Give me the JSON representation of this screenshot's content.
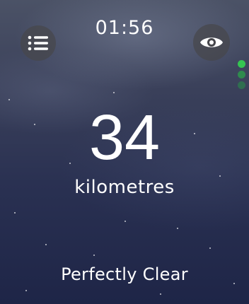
{
  "status": {
    "time": "01:56"
  },
  "controls": {
    "menu_icon": "list-icon",
    "eye_icon": "eye-icon"
  },
  "page_indicator": {
    "count": 3,
    "active_index": 0,
    "colors": [
      "#35c452",
      "#2f8a4e",
      "#2f6e50"
    ]
  },
  "visibility": {
    "value": "34",
    "unit": "kilometres",
    "description": "Perfectly Clear"
  }
}
